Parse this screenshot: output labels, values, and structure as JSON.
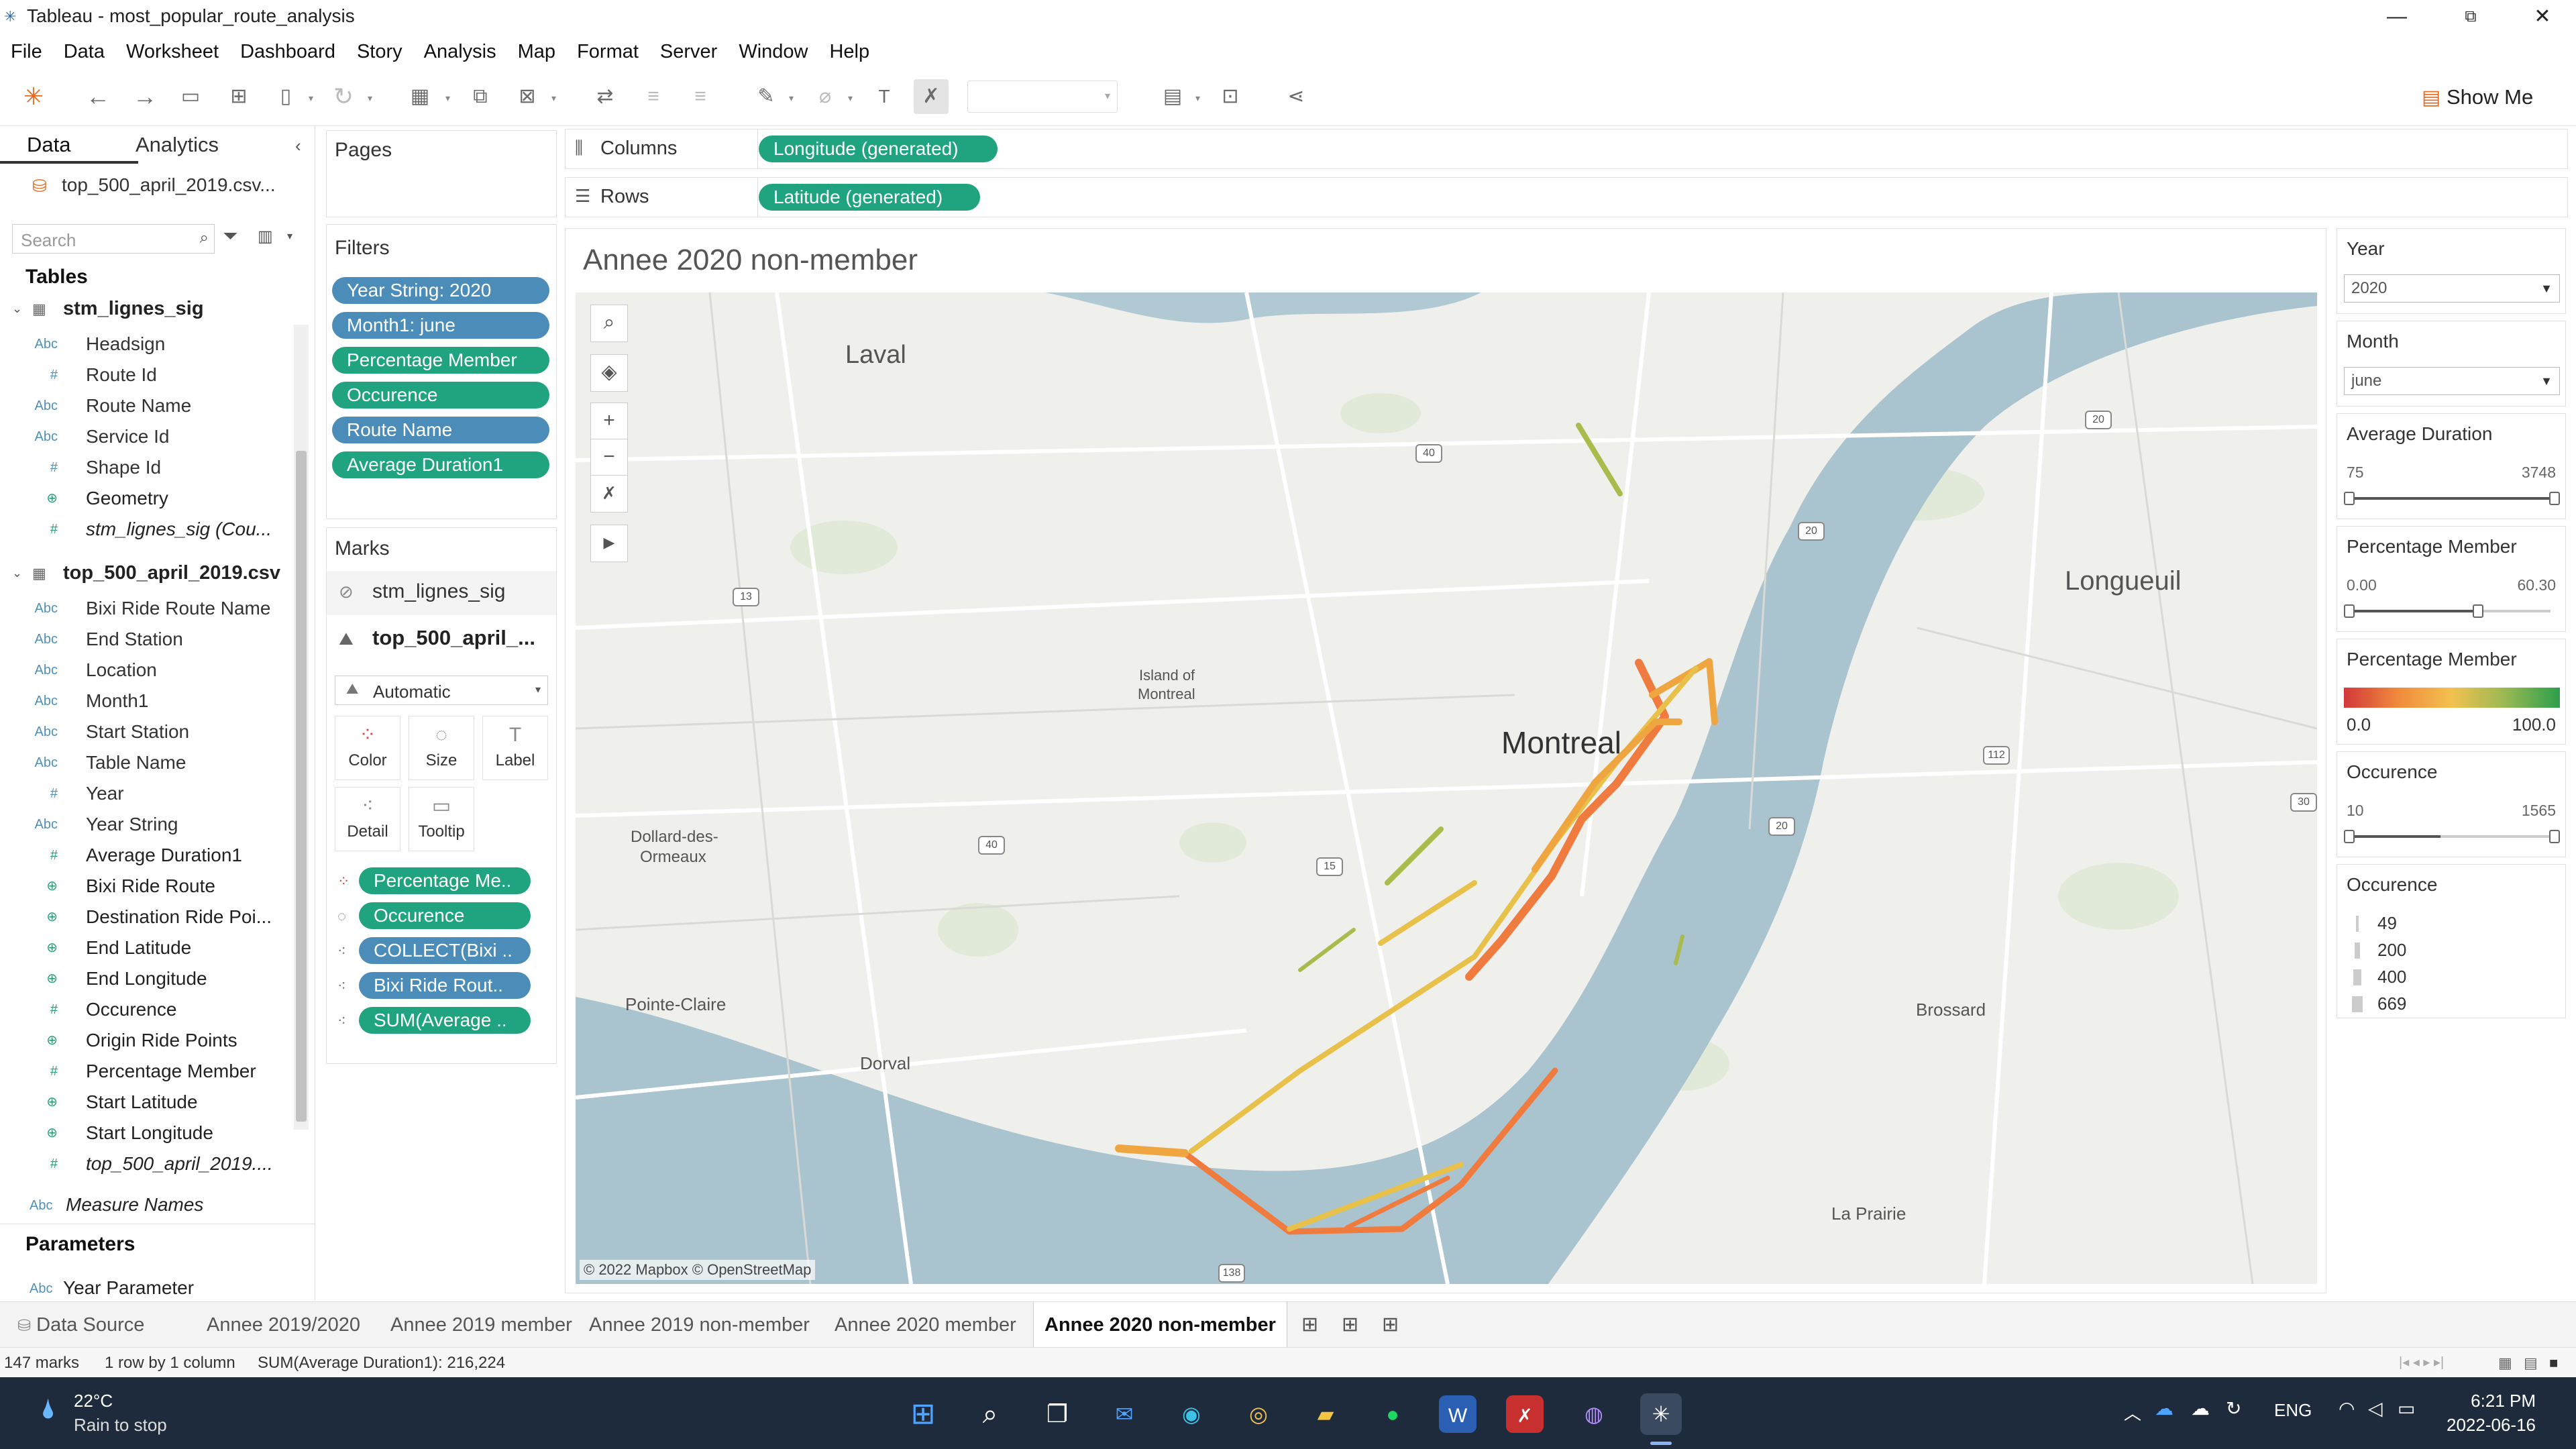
{
  "window": {
    "title": "Tableau - most_popular_route_analysis",
    "minimize": "—",
    "maximize": "⧉",
    "close": "✕"
  },
  "menu": [
    "File",
    "Data",
    "Worksheet",
    "Dashboard",
    "Story",
    "Analysis",
    "Map",
    "Format",
    "Server",
    "Window",
    "Help"
  ],
  "toolbar": {
    "show_me": "Show Me"
  },
  "data_pane": {
    "tab_data": "Data",
    "tab_analytics": "Analytics",
    "datasource": "top_500_april_2019.csv...",
    "search_placeholder": "Search",
    "tables_head": "Tables",
    "table1": {
      "name": "stm_lignes_sig",
      "fields": [
        {
          "icon": "Abc",
          "name": "Headsign",
          "kind": "dim"
        },
        {
          "icon": "#",
          "name": "Route Id",
          "kind": "dim"
        },
        {
          "icon": "Abc",
          "name": "Route Name",
          "kind": "dim"
        },
        {
          "icon": "Abc",
          "name": "Service Id",
          "kind": "dim"
        },
        {
          "icon": "#",
          "name": "Shape Id",
          "kind": "dim"
        },
        {
          "icon": "⊕",
          "name": "Geometry",
          "kind": "mea"
        },
        {
          "icon": "#",
          "name": "stm_lignes_sig (Cou...",
          "kind": "mea",
          "italic": true
        }
      ]
    },
    "table2": {
      "name": "top_500_april_2019.csv",
      "fields": [
        {
          "icon": "Abc",
          "name": "Bixi Ride Route Name",
          "kind": "dim"
        },
        {
          "icon": "Abc",
          "name": "End Station",
          "kind": "dim"
        },
        {
          "icon": "Abc",
          "name": "Location",
          "kind": "dim"
        },
        {
          "icon": "Abc",
          "name": "Month1",
          "kind": "dim"
        },
        {
          "icon": "Abc",
          "name": "Start Station",
          "kind": "dim"
        },
        {
          "icon": "Abc",
          "name": "Table Name",
          "kind": "dim"
        },
        {
          "icon": "#",
          "name": "Year",
          "kind": "dim"
        },
        {
          "icon": "Abc",
          "name": "Year String",
          "kind": "dim"
        },
        {
          "icon": "#",
          "name": "Average Duration1",
          "kind": "mea"
        },
        {
          "icon": "⊕",
          "name": "Bixi Ride Route",
          "kind": "mea"
        },
        {
          "icon": "⊕",
          "name": "Destination Ride Poi...",
          "kind": "mea"
        },
        {
          "icon": "⊕",
          "name": "End Latitude",
          "kind": "mea"
        },
        {
          "icon": "⊕",
          "name": "End Longitude",
          "kind": "mea"
        },
        {
          "icon": "#",
          "name": "Occurence",
          "kind": "mea"
        },
        {
          "icon": "⊕",
          "name": "Origin Ride Points",
          "kind": "mea"
        },
        {
          "icon": "#",
          "name": "Percentage Member",
          "kind": "mea"
        },
        {
          "icon": "⊕",
          "name": "Start Latitude",
          "kind": "mea"
        },
        {
          "icon": "⊕",
          "name": "Start Longitude",
          "kind": "mea"
        },
        {
          "icon": "#",
          "name": "top_500_april_2019....",
          "kind": "mea",
          "italic": true
        }
      ]
    },
    "measure_names": "Measure Names",
    "parameters_head": "Parameters",
    "parameter1": "Year Parameter"
  },
  "pages_label": "Pages",
  "filters_label": "Filters",
  "filters": [
    {
      "label": "Year String: 2020",
      "color": "blue"
    },
    {
      "label": "Month1: june",
      "color": "blue"
    },
    {
      "label": "Percentage Member",
      "color": "green"
    },
    {
      "label": "Occurence",
      "color": "green"
    },
    {
      "label": "Route Name",
      "color": "blue"
    },
    {
      "label": "Average Duration1",
      "color": "green"
    }
  ],
  "marks": {
    "label": "Marks",
    "layer1": "stm_lignes_sig",
    "layer2": "top_500_april_...",
    "type": "Automatic",
    "buttons": [
      "Color",
      "Size",
      "Label",
      "Detail",
      "Tooltip"
    ],
    "pills": [
      {
        "label": "Percentage Me..",
        "color": "green",
        "icon": "color"
      },
      {
        "label": "Occurence",
        "color": "green",
        "icon": "size"
      },
      {
        "label": "COLLECT(Bixi ..",
        "color": "blue",
        "icon": "detail"
      },
      {
        "label": "Bixi Ride Rout..",
        "color": "blue",
        "icon": "detail"
      },
      {
        "label": "SUM(Average ..",
        "color": "green",
        "icon": "detail"
      }
    ]
  },
  "shelves": {
    "columns_label": "Columns",
    "rows_label": "Rows",
    "columns_pill": "Longitude (generated)",
    "rows_pill": "Latitude (generated)"
  },
  "view": {
    "title": "Annee 2020 non-member",
    "attribution": "© 2022 Mapbox © OpenStreetMap",
    "places": {
      "laval": "Laval",
      "longueuil": "Longueuil",
      "montreal": "Montreal",
      "island": "Island of",
      "island2": "Montreal",
      "dollard": "Dollard-des-",
      "dollard2": "Ormeaux",
      "pointe": "Pointe-Claire",
      "dorval": "Dorval",
      "brossard": "Brossard",
      "laprairie": "La Prairie"
    },
    "shields": [
      "40",
      "20",
      "13",
      "20",
      "112",
      "40",
      "15",
      "20",
      "30",
      "138"
    ]
  },
  "cards": {
    "year": {
      "title": "Year",
      "value": "2020"
    },
    "month": {
      "title": "Month",
      "value": "june"
    },
    "avg_duration": {
      "title": "Average Duration",
      "min": "75",
      "max": "3748"
    },
    "pct_member": {
      "title": "Percentage Member",
      "min": "0.00",
      "max": "60.30"
    },
    "pct_legend": {
      "title": "Percentage Member",
      "min": "0.0",
      "max": "100.0"
    },
    "occurence_filter": {
      "title": "Occurence",
      "min": "10",
      "max": "1565"
    },
    "occurence_legend": {
      "title": "Occurence",
      "items": [
        "49",
        "200",
        "400",
        "669"
      ]
    }
  },
  "sheets": {
    "datasource": "Data Source",
    "tabs": [
      "Annee 2019/2020",
      "Annee 2019 member",
      "Annee 2019 non-member",
      "Annee 2020 member",
      "Annee 2020 non-member"
    ]
  },
  "status": {
    "marks": "147 marks",
    "dims": "1 row by 1 column",
    "sum": "SUM(Average Duration1): 216,224"
  },
  "taskbar": {
    "temp": "22°C",
    "weather": "Rain to stop",
    "lang": "ENG",
    "time": "6:21 PM",
    "date": "2022-06-16"
  },
  "colors": {
    "tableau_blue": "#4b8db8",
    "tableau_green": "#1fa47f",
    "route_orange": "#f07b3f",
    "route_yellow": "#e8c14a",
    "route_green": "#a8bb4c"
  }
}
